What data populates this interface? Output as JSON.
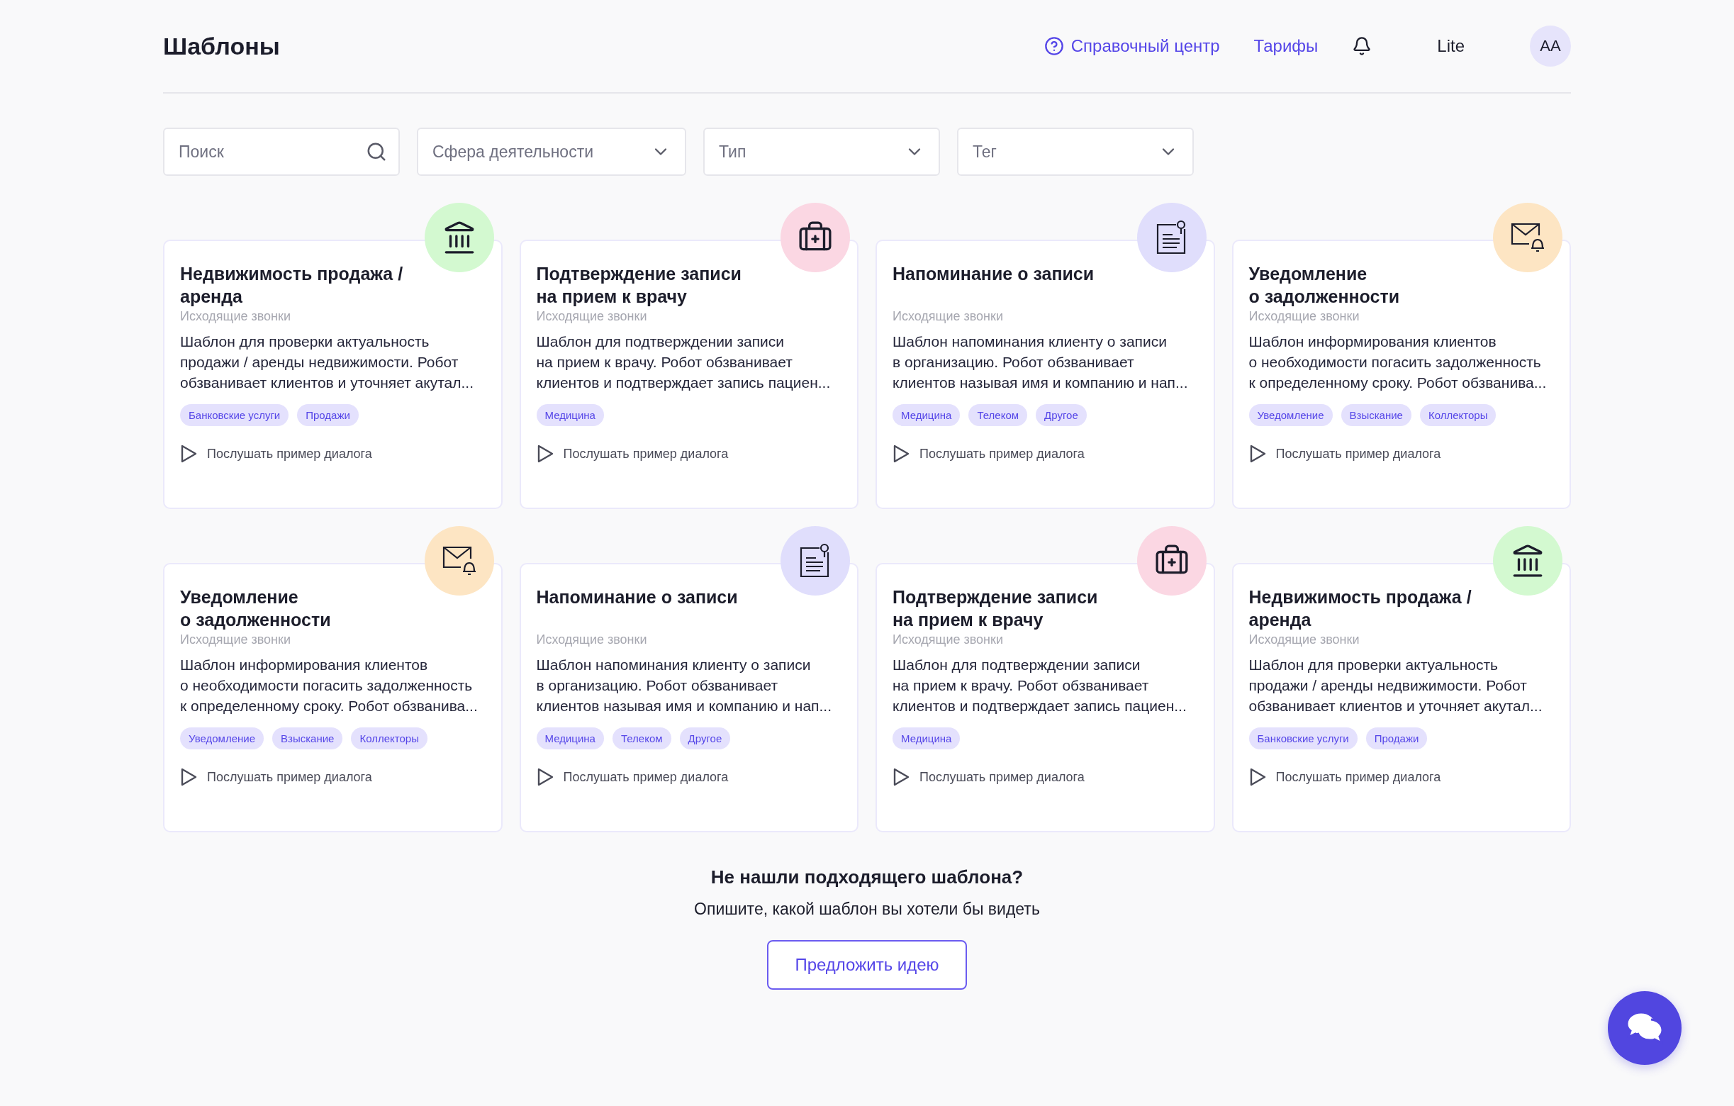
{
  "header": {
    "title": "Шаблоны",
    "help_link": "Справочный центр",
    "pricing_link": "Тарифы",
    "plan": "Lite",
    "avatar": "AA"
  },
  "filters": {
    "search": {
      "placeholder": "Поиск"
    },
    "dropdowns": [
      {
        "placeholder": "Сфера деятельности"
      },
      {
        "placeholder": "Тип"
      },
      {
        "placeholder": "Тег"
      }
    ]
  },
  "cards": [
    {
      "kind": "bank",
      "title": "Недвижимость продажа /\nаренда",
      "subtitle": "Исходящие звонки",
      "description": "Шаблон для проверки актуальность\nпродажи / аренды недвижимости. Робот\nобзванивает клиентов и уточняет акутал...",
      "tags": [
        "Банковские услуги",
        "Продажи"
      ],
      "listen": "Послушать пример диалога"
    },
    {
      "kind": "medical",
      "title": "Подтверждение записи\nна прием к врачу",
      "subtitle": "Исходящие звонки",
      "description": "Шаблон для подтверждении записи\nна прием к врачу. Робот обзванивает\nклиентов и подтверждает запись пациен...",
      "tags": [
        "Медицина"
      ],
      "listen": "Послушать пример диалога"
    },
    {
      "kind": "note",
      "title": "Напоминание о записи",
      "subtitle": "Исходящие звонки",
      "description": "Шаблон напоминания клиенту о записи\nв организацию. Робот обзванивает\nклиентов называя имя и компанию и нап...",
      "tags": [
        "Медицина",
        "Телеком",
        "Другое"
      ],
      "listen": "Послушать пример диалога"
    },
    {
      "kind": "mail",
      "title": "Уведомление\nо задолженности",
      "subtitle": "Исходящие звонки",
      "description": "Шаблон информирования клиентов\nо необходимости погасить задолженность\nк определенному сроку. Робот обзванива...",
      "tags": [
        "Уведомление",
        "Взыскание",
        "Коллекторы"
      ],
      "listen": "Послушать пример диалога"
    },
    {
      "kind": "mail",
      "title": "Уведомление\nо задолженности",
      "subtitle": "Исходящие звонки",
      "description": "Шаблон информирования клиентов\nо необходимости погасить задолженность\nк определенному сроку. Робот обзванива...",
      "tags": [
        "Уведомление",
        "Взыскание",
        "Коллекторы"
      ],
      "listen": "Послушать пример диалога"
    },
    {
      "kind": "note",
      "title": "Напоминание о записи",
      "subtitle": "Исходящие звонки",
      "description": "Шаблон напоминания клиенту о записи\nв организацию. Робот обзванивает\nклиентов называя имя и компанию и нап...",
      "tags": [
        "Медицина",
        "Телеком",
        "Другое"
      ],
      "listen": "Послушать пример диалога"
    },
    {
      "kind": "medical",
      "title": "Подтверждение записи\nна прием к врачу",
      "subtitle": "Исходящие звонки",
      "description": "Шаблон для подтверждении записи\nна прием к врачу. Робот обзванивает\nклиентов и подтверждает запись пациен...",
      "tags": [
        "Медицина"
      ],
      "listen": "Послушать пример диалога"
    },
    {
      "kind": "bank",
      "title": "Недвижимость продажа /\nаренда",
      "subtitle": "Исходящие звонки",
      "description": "Шаблон для проверки актуальность\nпродажи / аренды недвижимости. Робот\nобзванивает клиентов и уточняет акутал...",
      "tags": [
        "Банковские услуги",
        "Продажи"
      ],
      "listen": "Послушать пример диалога"
    }
  ],
  "footer": {
    "title": "Не нашли подходящего шаблона?",
    "subtitle": "Опишите, какой шаблон вы хотели бы видеть",
    "button": "Предложить идею"
  }
}
